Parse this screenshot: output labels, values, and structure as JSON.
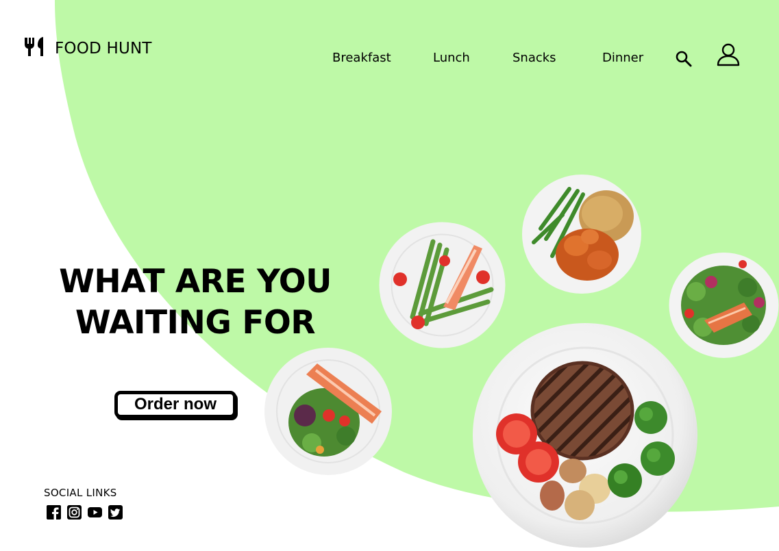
{
  "brand": {
    "name": "FOOD HUNT",
    "logo_icon": "fork-knife-icon"
  },
  "nav": {
    "items": [
      {
        "label": "Breakfast"
      },
      {
        "label": "Lunch"
      },
      {
        "label": "Snacks"
      },
      {
        "label": "Dinner"
      }
    ],
    "search_icon": "search-icon",
    "profile_icon": "user-icon"
  },
  "hero": {
    "title_line1": "WHAT ARE YOU",
    "title_line2": "WAITING FOR",
    "cta_label": "Order now"
  },
  "social": {
    "label": "SOCIAL LINKS",
    "icons": [
      "facebook-icon",
      "instagram-icon",
      "youtube-icon",
      "twitter-icon"
    ]
  },
  "colors": {
    "accent_green": "#BEF9A7",
    "text": "#000000",
    "background": "#FFFFFF"
  }
}
